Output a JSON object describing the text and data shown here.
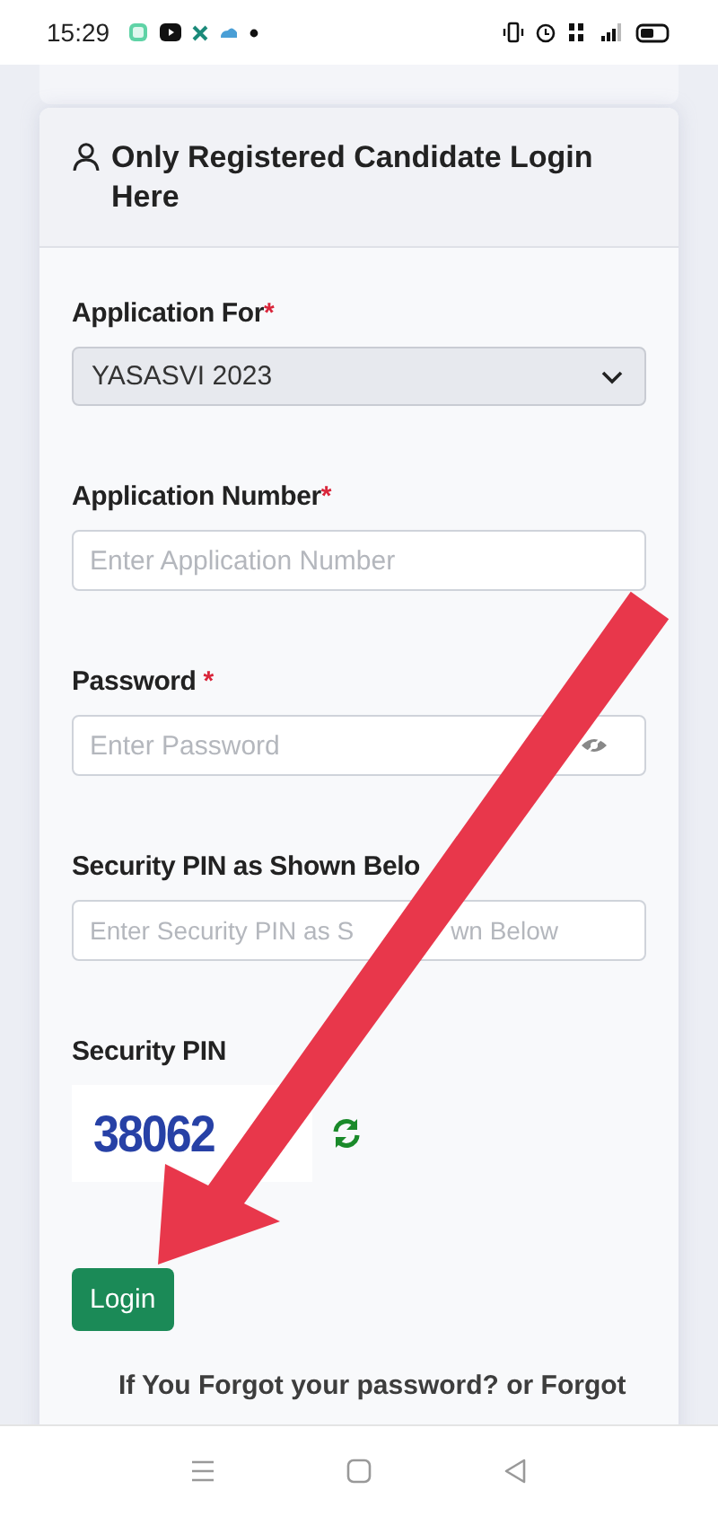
{
  "status_bar": {
    "time": "15:29"
  },
  "header": {
    "title": "Only Registered Candidate Login Here"
  },
  "fields": [
    {
      "kind": "select",
      "label": "Application For",
      "required_mark": "*",
      "value": "YASASVI 2023"
    },
    {
      "kind": "text",
      "label": "Application Number",
      "required_mark": "*",
      "placeholder": "Enter Application Number"
    },
    {
      "kind": "password",
      "label": "Password",
      "required_mark": "*",
      "placeholder": "Enter Password"
    },
    {
      "kind": "split",
      "label": "Security PIN as Shown Belo",
      "placeholder": "Enter Security PIN as S",
      "placeholder_after_arrow": "wn Below"
    }
  ],
  "captcha": {
    "label": "Security PIN",
    "code": "38062"
  },
  "login_button": "Login",
  "forgot_text": "If You Forgot your password? or Forgot"
}
